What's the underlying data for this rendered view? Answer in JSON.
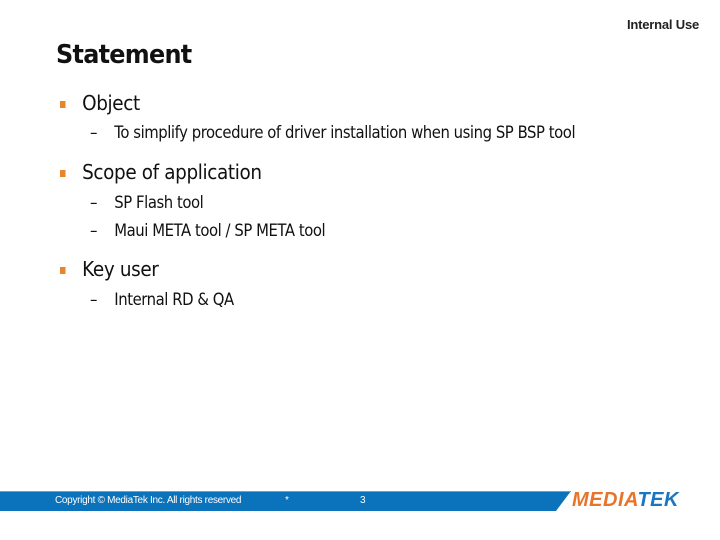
{
  "header": {
    "classification": "Internal Use",
    "title": "Statement"
  },
  "sections": [
    {
      "heading": "Object",
      "items": [
        "To simplify procedure of driver installation when using SP BSP tool"
      ]
    },
    {
      "heading": "Scope of application",
      "items": [
        "SP Flash tool",
        "Maui META tool / SP META tool"
      ]
    },
    {
      "heading": "Key user",
      "items": [
        "Internal RD & QA"
      ]
    }
  ],
  "footer": {
    "copyright": "Copyright © MediaTek Inc. All rights reserved",
    "marker": "*",
    "page_number": "3",
    "logo_part1": "MEDIA",
    "logo_part2": "TEK"
  },
  "colors": {
    "bullet": "#e8852c",
    "footer_bar": "#0b72bc",
    "logo_orange": "#e8742c",
    "logo_blue": "#1a76c2"
  }
}
